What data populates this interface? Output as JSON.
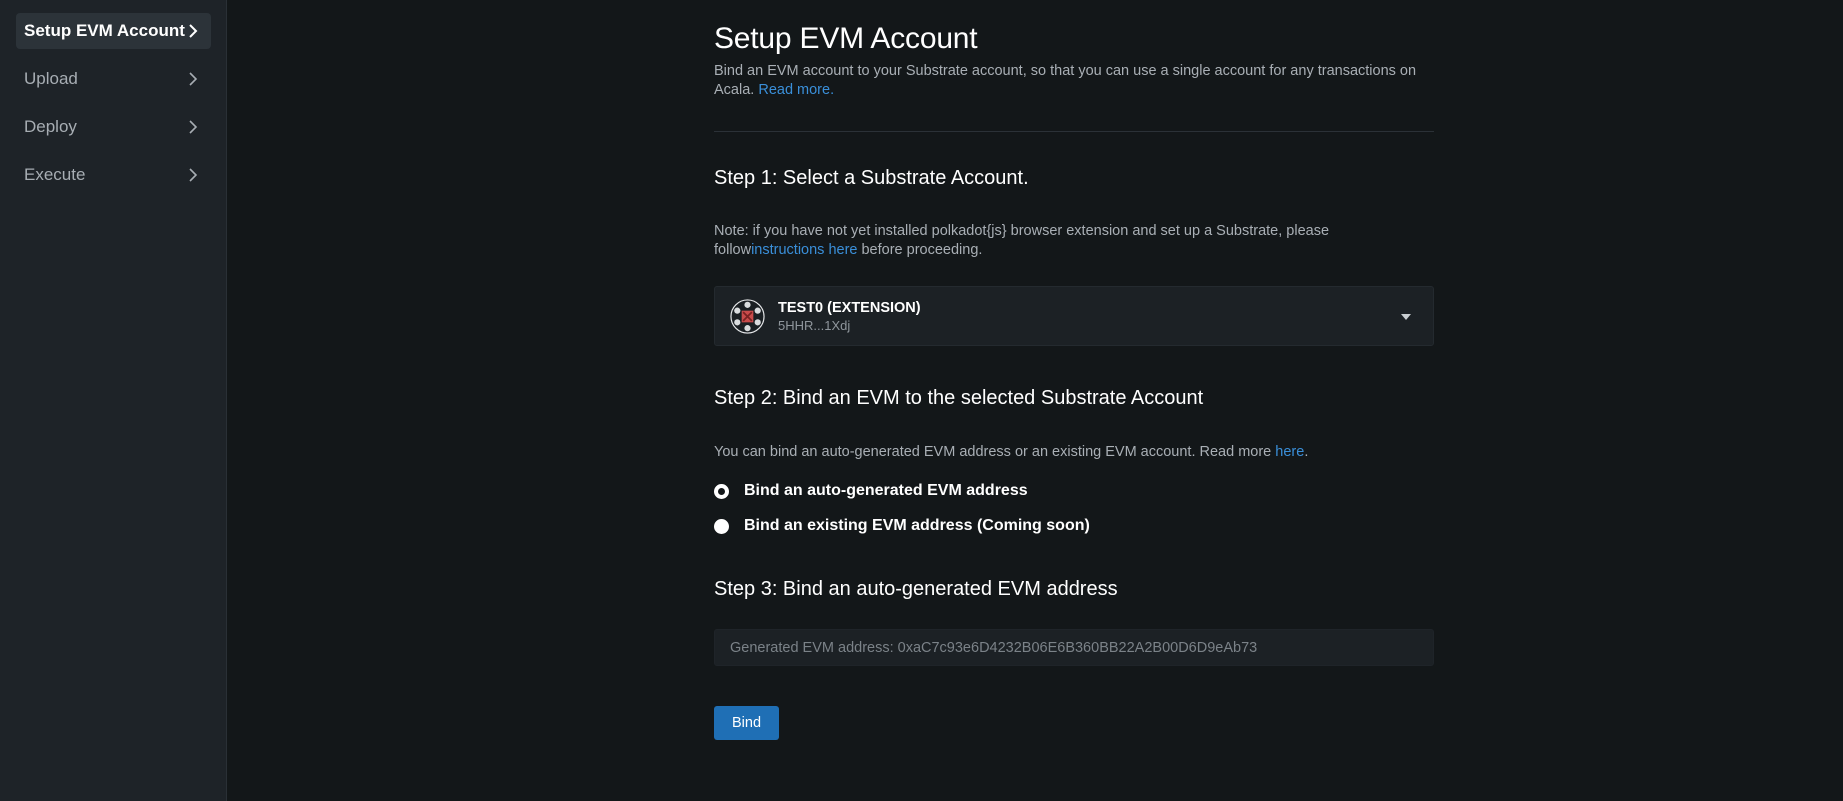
{
  "sidebar": {
    "items": [
      {
        "label": "Setup EVM Account",
        "active": true
      },
      {
        "label": "Upload",
        "active": false
      },
      {
        "label": "Deploy",
        "active": false
      },
      {
        "label": "Execute",
        "active": false
      }
    ]
  },
  "main": {
    "title": "Setup EVM Account",
    "intro": "Bind an EVM account to your Substrate account, so that you can use a single account for any transactions on Acala.",
    "intro_link": "Read more.",
    "step1": {
      "title": "Step 1: Select a Substrate Account.",
      "note_prefix": "Note: if you have not yet installed polkadot{js} browser extension and set up a Substrate, please follow",
      "note_link": "instructions here",
      "note_suffix": " before proceeding.",
      "account": {
        "name": "TEST0 (EXTENSION)",
        "address": "5HHR...1Xdj",
        "icon": "polkadot-identicon"
      }
    },
    "step2": {
      "title": "Step 2: Bind an EVM to the selected Substrate Account",
      "desc": "You can bind an auto-generated EVM address or an existing EVM account. Read more ",
      "desc_link": "here",
      "desc_end": ".",
      "options": [
        {
          "label": "Bind an auto-generated EVM address",
          "checked": true
        },
        {
          "label": "Bind an existing EVM address (Coming soon)",
          "checked": false
        }
      ]
    },
    "step3": {
      "title": "Step 3: Bind an auto-generated EVM address",
      "address_label": "Generated EVM address: 0xaC7c93e6D4232B06E6B360BB22A2B00D6D9eAb73"
    },
    "bind_button": "Bind"
  },
  "colors": {
    "background": "#131719",
    "sidebar": "#1e2328",
    "link": "#3a8fd9",
    "button": "#1f6fb5"
  }
}
